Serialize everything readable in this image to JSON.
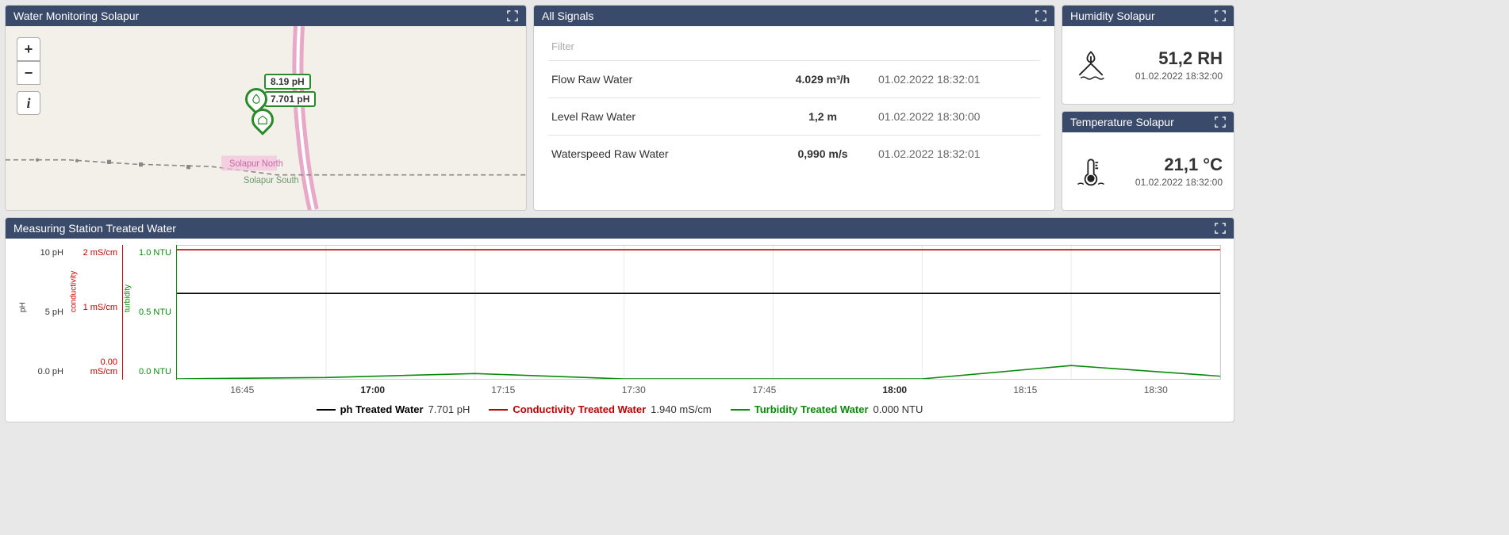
{
  "panels": {
    "map": {
      "title": "Water Monitoring Solapur"
    },
    "signals": {
      "title": "All Signals",
      "filter_placeholder": "Filter"
    },
    "humidity": {
      "title": "Humidity Solapur",
      "value": "51,2 RH",
      "timestamp": "01.02.2022  18:32:00"
    },
    "temperature": {
      "title": "Temperature Solapur",
      "value": "21,1 °C",
      "timestamp": "01.02.2022  18:32:00"
    },
    "chart": {
      "title": "Measuring Station Treated Water"
    }
  },
  "map": {
    "ph_badge_1": "8.19 pH",
    "ph_badge_2": "7.701 pH",
    "label_north": "Solapur North",
    "label_south": "Solapur South"
  },
  "signals": [
    {
      "name": "Flow Raw Water",
      "value": "4.029 m³/h",
      "timestamp": "01.02.2022 18:32:01"
    },
    {
      "name": "Level Raw Water",
      "value": "1,2 m",
      "timestamp": "01.02.2022 18:30:00"
    },
    {
      "name": "Waterspeed Raw Water",
      "value": "0,990 m/s",
      "timestamp": "01.02.2022 18:32:01"
    }
  ],
  "chart_data": {
    "type": "line",
    "x": [
      "16:45",
      "17:00",
      "17:15",
      "17:30",
      "17:45",
      "18:00",
      "18:15",
      "18:30"
    ],
    "x_bold": [
      "17:00",
      "18:00"
    ],
    "axes": [
      {
        "id": "ph",
        "label": "pH",
        "color": "#000000",
        "ticks": [
          "10 pH",
          "5 pH",
          "0.0 pH"
        ],
        "range": [
          0,
          12
        ]
      },
      {
        "id": "conductivity",
        "label": "conductivity",
        "color": "#c00000",
        "ticks": [
          "2 mS/cm",
          "1 mS/cm",
          "0.00 mS/cm"
        ],
        "range": [
          0,
          2
        ]
      },
      {
        "id": "turbidity",
        "label": "turbidity",
        "color": "#0a8a0a",
        "ticks": [
          "1.0 NTU",
          "0.5 NTU",
          "0.0 NTU"
        ],
        "range": [
          0,
          1
        ]
      }
    ],
    "series": [
      {
        "name": "ph Treated Water",
        "axis": "ph",
        "color": "#000000",
        "legend_value": "7.701 pH",
        "values": [
          7.7,
          7.7,
          7.7,
          7.7,
          7.7,
          7.7,
          7.7,
          7.7
        ]
      },
      {
        "name": "Conductivity Treated Water",
        "axis": "conductivity",
        "color": "#c00000",
        "legend_value": "1.940 mS/cm",
        "values": [
          1.94,
          1.94,
          1.94,
          1.94,
          1.94,
          1.94,
          1.94,
          1.94
        ]
      },
      {
        "name": "Turbidity Treated Water",
        "axis": "turbidity",
        "color": "#0a8a0a",
        "legend_value": "0.000 NTU",
        "values": [
          0.0,
          0.01,
          0.04,
          0.0,
          0.0,
          0.0,
          0.1,
          0.02
        ]
      }
    ]
  }
}
